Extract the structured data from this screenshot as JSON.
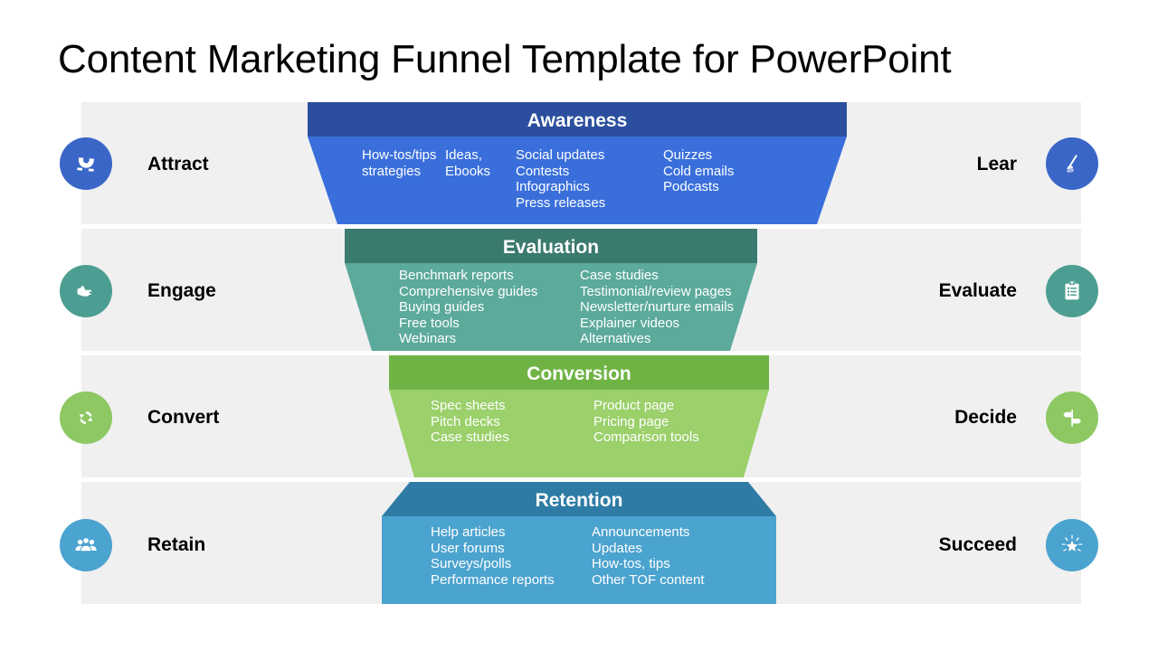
{
  "title": "Content Marketing Funnel Template for PowerPoint",
  "colors": {
    "band_background": "#F0F0F0",
    "page_background": "#FFFFFF",
    "title_text": "#000000",
    "stage_text": "#FFFFFF"
  },
  "rows": [
    {
      "left_label": "Attract",
      "left_icon": "magnet-icon",
      "right_label": "Lear",
      "right_icon": "broom-icon",
      "icon_color": "#3A66C8",
      "stage": {
        "name": "Awareness",
        "header_color": "#2B4F9E",
        "body_color": "#3A6FDB",
        "columns": [
          [
            "How-tos/tips",
            "strategies"
          ],
          [
            "Ideas,",
            "Ebooks"
          ],
          [
            "Social updates",
            "Contests",
            "Infographics",
            "Press releases"
          ],
          [
            "Quizzes",
            "Cold emails",
            "Podcasts"
          ]
        ]
      }
    },
    {
      "left_label": "Engage",
      "left_icon": "pointing-hand-icon",
      "right_label": "Evaluate",
      "right_icon": "clipboard-checklist-icon",
      "icon_color": "#4D9E92",
      "stage": {
        "name": "Evaluation",
        "header_color": "#3B7A6E",
        "body_color": "#5CAA9C",
        "columns": [
          [
            "Benchmark reports",
            "Comprehensive guides",
            "Buying guides",
            "Free tools",
            "Webinars"
          ],
          [
            "Case studies",
            "Testimonial/review pages",
            "Newsletter/nurture emails",
            "Explainer videos",
            "Alternatives"
          ]
        ]
      }
    },
    {
      "left_label": "Convert",
      "left_icon": "refresh-cycle-icon",
      "right_label": "Decide",
      "right_icon": "signpost-icon",
      "icon_color": "#8DC863",
      "stage": {
        "name": "Conversion",
        "header_color": "#6FB344",
        "body_color": "#9BD06B",
        "columns": [
          [
            "Spec sheets",
            "Pitch decks",
            "Case studies"
          ],
          [
            "Product page",
            "Pricing page",
            "Comparison tools"
          ]
        ]
      }
    },
    {
      "left_label": "Retain",
      "left_icon": "people-group-icon",
      "right_label": "Succeed",
      "right_icon": "shining-star-icon",
      "icon_color": "#4BA3CF",
      "stage": {
        "name": "Retention",
        "header_color": "#2E7CA5",
        "body_color": "#4BA3CF",
        "columns": [
          [
            "Help articles",
            "User forums",
            "Surveys/polls",
            "Performance reports"
          ],
          [
            "Announcements",
            "Updates",
            "How-tos, tips",
            "Other TOF content"
          ]
        ]
      }
    }
  ]
}
